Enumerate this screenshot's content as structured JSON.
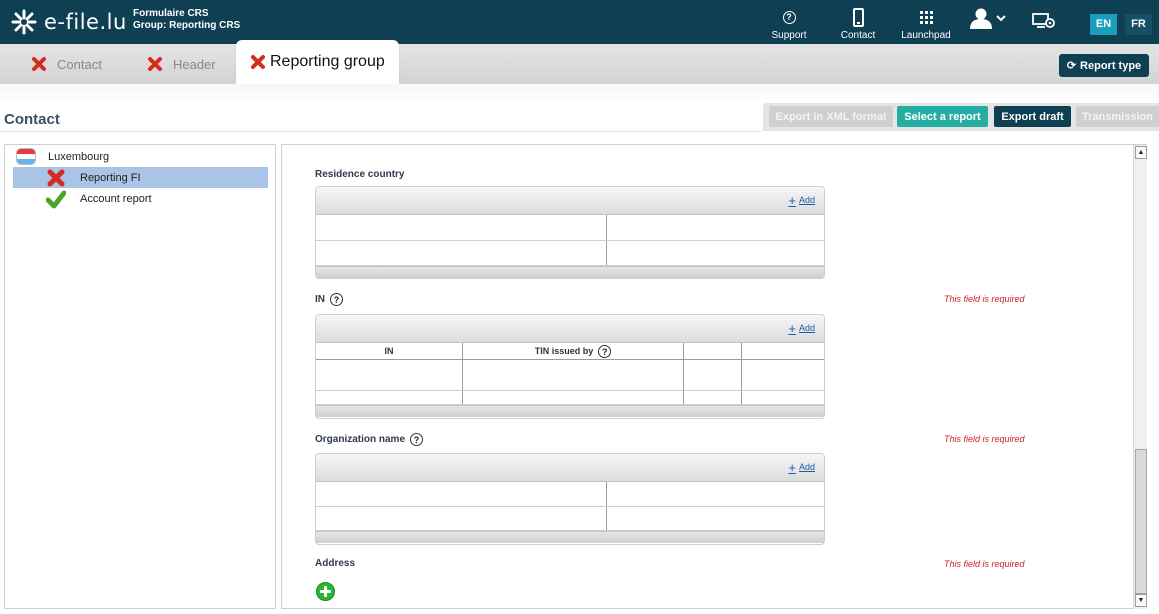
{
  "app": {
    "logo_text": "e-file.lu",
    "form_line": "Formulaire CRS",
    "group_line": "Group: Reporting CRS"
  },
  "nav": {
    "support": "Support",
    "contact": "Contact",
    "launchpad": "Launchpad",
    "user_icon": "user-icon",
    "settings_icon": "computer-settings-icon"
  },
  "languages": {
    "en": "EN",
    "fr": "FR"
  },
  "tabs": [
    {
      "label": "Contact",
      "status": "invalid"
    },
    {
      "label": "Header",
      "status": "invalid"
    },
    {
      "label": "Reporting group",
      "status": "invalid",
      "active": true
    }
  ],
  "report_type_button": "Report type",
  "section_title": "Contact",
  "actions": {
    "export_xml": "Export in XML format",
    "select_report": "Select a report",
    "export_draft": "Export draft",
    "transmission": "Transmission"
  },
  "tree": {
    "root": "Luxembourg",
    "items": [
      {
        "label": "Reporting FI",
        "status": "invalid",
        "selected": true
      },
      {
        "label": "Account report",
        "status": "valid"
      }
    ]
  },
  "form": {
    "residence_country": {
      "label": "Residence country",
      "add": "Add"
    },
    "in": {
      "label": "IN",
      "required": "This field is required",
      "add": "Add",
      "columns": [
        "IN",
        "TIN issued by",
        "",
        ""
      ]
    },
    "organization_name": {
      "label": "Organization name",
      "required": "This field is required",
      "add": "Add"
    },
    "address": {
      "label": "Address",
      "required": "This field is required"
    }
  },
  "colors": {
    "topbar": "#0f3f52",
    "accent_teal": "#27aea4",
    "language_active": "#1b9ebd",
    "error_red": "#c9231f"
  }
}
